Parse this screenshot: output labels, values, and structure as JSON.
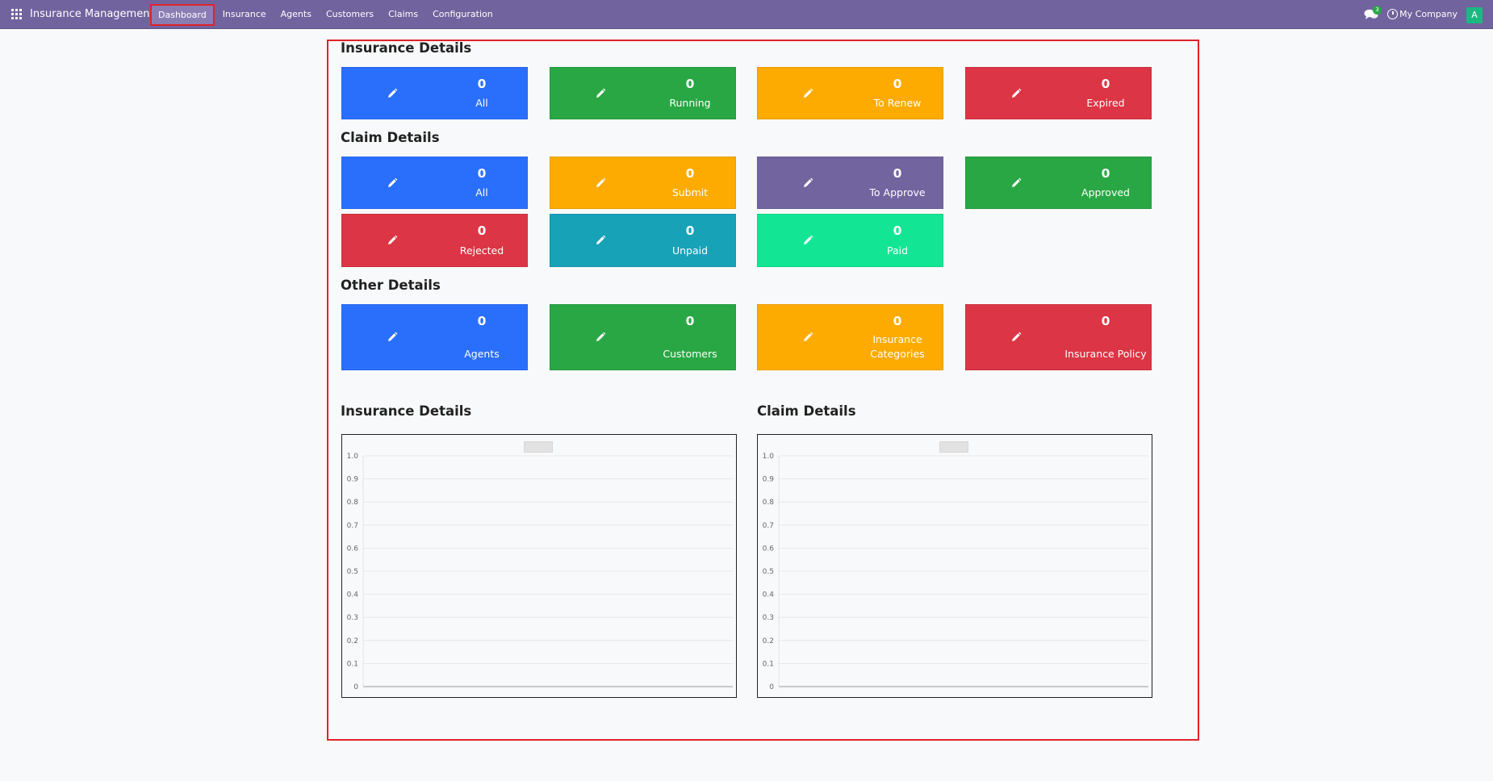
{
  "navbar": {
    "app_name": "Insurance Management",
    "menu": [
      "Dashboard",
      "Insurance",
      "Agents",
      "Customers",
      "Claims",
      "Configuration"
    ],
    "active": "Dashboard",
    "chat_badge": "3",
    "company": "My Company",
    "avatar_initial": "A"
  },
  "sections": {
    "insurance_title": "Insurance Details",
    "claim_title": "Claim Details",
    "other_title": "Other Details"
  },
  "insurance_cards": [
    {
      "count": "0",
      "label": "All",
      "color": "#2a6ffc",
      "icon": "pencil-icon"
    },
    {
      "count": "0",
      "label": "Running",
      "color": "#29a744",
      "icon": "pencil-icon"
    },
    {
      "count": "0",
      "label": "To Renew",
      "color": "#fdab00",
      "icon": "pencil-icon"
    },
    {
      "count": "0",
      "label": "Expired",
      "color": "#dc3545",
      "icon": "pencil-icon"
    }
  ],
  "claim_cards": [
    {
      "count": "0",
      "label": "All",
      "color": "#2a6ffc"
    },
    {
      "count": "0",
      "label": "Submit",
      "color": "#fdab00"
    },
    {
      "count": "0",
      "label": "To Approve",
      "color": "#72649f"
    },
    {
      "count": "0",
      "label": "Approved",
      "color": "#29a744"
    },
    {
      "count": "0",
      "label": "Rejected",
      "color": "#dc3545"
    },
    {
      "count": "0",
      "label": "Unpaid",
      "color": "#17a2b8"
    },
    {
      "count": "0",
      "label": "Paid",
      "color": "#12e694"
    }
  ],
  "other_cards": [
    {
      "count": "0",
      "label": "Agents",
      "color": "#2a6ffc"
    },
    {
      "count": "0",
      "label": "Customers",
      "color": "#29a744"
    },
    {
      "count": "0",
      "label": "Insurance Categories",
      "color": "#fdab00"
    },
    {
      "count": "0",
      "label": "Insurance Policy",
      "color": "#dc3545"
    }
  ],
  "charts": {
    "insurance_title": "Insurance Details",
    "claim_title": "Claim Details"
  },
  "chart_data": [
    {
      "type": "bar",
      "title": "",
      "categories": [],
      "series": [],
      "ylim": [
        0,
        1.0
      ],
      "yticks": [
        "0",
        "0.1",
        "0.2",
        "0.3",
        "0.4",
        "0.5",
        "0.6",
        "0.7",
        "0.8",
        "0.9",
        "1.0"
      ],
      "grid": true
    },
    {
      "type": "bar",
      "title": "",
      "categories": [],
      "series": [],
      "ylim": [
        0,
        1.0
      ],
      "yticks": [
        "0",
        "0.1",
        "0.2",
        "0.3",
        "0.4",
        "0.5",
        "0.6",
        "0.7",
        "0.8",
        "0.9",
        "1.0"
      ],
      "grid": true
    }
  ]
}
